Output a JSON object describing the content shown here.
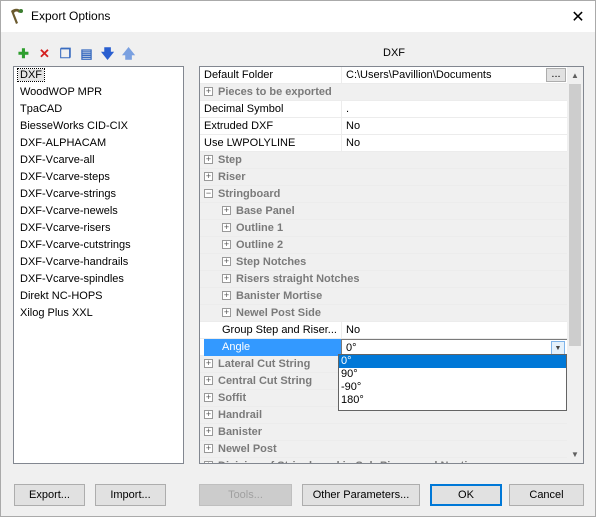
{
  "window": {
    "title": "Export Options",
    "close_glyph": "✕"
  },
  "toolbar": {
    "buttons": [
      {
        "icon": "add-icon",
        "glyph": "✚",
        "color": "#2e9e2e"
      },
      {
        "icon": "delete-icon",
        "glyph": "✕",
        "color": "#d42020"
      },
      {
        "icon": "copy-icon",
        "glyph": "❐",
        "color": "#3a6cc0"
      },
      {
        "icon": "rename-icon",
        "glyph": "▤",
        "color": "#3a6cc0"
      },
      {
        "icon": "move-down-icon",
        "glyph": "🡇",
        "color": "#2a5fd0"
      },
      {
        "icon": "move-up-icon",
        "glyph": "🡅",
        "color": "#7aa0e0"
      }
    ]
  },
  "formats": {
    "items": [
      "DXF",
      "WoodWOP MPR",
      "TpaCAD",
      "BiesseWorks CID-CIX",
      "DXF-ALPHACAM",
      "DXF-Vcarve-all",
      "DXF-Vcarve-steps",
      "DXF-Vcarve-strings",
      "DXF-Vcarve-newels",
      "DXF-Vcarve-risers",
      "DXF-Vcarve-cutstrings",
      "DXF-Vcarve-handrails",
      "DXF-Vcarve-spindles",
      "Direkt NC-HOPS",
      "Xilog Plus XXL"
    ],
    "selected_index": 0
  },
  "properties": {
    "title": "DXF",
    "rows": [
      {
        "type": "prop",
        "name": "Default Folder",
        "value": "C:\\Users\\Pavillion\\Documents",
        "has_browse": true,
        "browse_label": "..."
      },
      {
        "type": "cat",
        "name": "Pieces to be exported",
        "expander": "+"
      },
      {
        "type": "prop",
        "name": "Decimal Symbol",
        "value": "."
      },
      {
        "type": "prop",
        "name": "Extruded DXF",
        "value": "No"
      },
      {
        "type": "prop",
        "name": "Use LWPOLYLINE",
        "value": "No"
      },
      {
        "type": "cat",
        "name": "Step",
        "expander": "+"
      },
      {
        "type": "cat",
        "name": "Riser",
        "expander": "+"
      },
      {
        "type": "cat",
        "name": "Stringboard",
        "expander": "−"
      },
      {
        "type": "subcat",
        "name": "Base Panel",
        "expander": "+"
      },
      {
        "type": "subcat",
        "name": "Outline 1",
        "expander": "+"
      },
      {
        "type": "subcat",
        "name": "Outline 2",
        "expander": "+"
      },
      {
        "type": "subcat",
        "name": "Step Notches",
        "expander": "+"
      },
      {
        "type": "subcat",
        "name": "Risers straight Notches",
        "expander": "+"
      },
      {
        "type": "subcat",
        "name": "Banister Mortise",
        "expander": "+"
      },
      {
        "type": "subcat",
        "name": "Newel Post Side",
        "expander": "+"
      },
      {
        "type": "subprop",
        "name": "Group Step and Riser...",
        "value": "No"
      },
      {
        "type": "subprop-edit",
        "name": "Angle",
        "value": "0°"
      },
      {
        "type": "cat",
        "name": "Lateral Cut String",
        "expander": "+"
      },
      {
        "type": "cat",
        "name": "Central Cut String",
        "expander": "+"
      },
      {
        "type": "cat",
        "name": "Soffit",
        "expander": "+"
      },
      {
        "type": "cat",
        "name": "Handrail",
        "expander": "+"
      },
      {
        "type": "cat",
        "name": "Banister",
        "expander": "+"
      },
      {
        "type": "cat",
        "name": "Newel Post",
        "expander": "+"
      },
      {
        "type": "cat",
        "name": "Division of Stringboard in Sub-Pieces and Nesting",
        "expander": "+"
      }
    ]
  },
  "angle_dropdown": {
    "options": [
      "0°",
      "90°",
      "-90°",
      "180°"
    ],
    "selected_index": 0
  },
  "buttons": {
    "export": "Export...",
    "import": "Import...",
    "tools": "Tools...",
    "other_parameters": "Other Parameters...",
    "ok": "OK",
    "cancel": "Cancel"
  },
  "colors": {
    "selection": "#3399ff",
    "dropdown_selection": "#0078d7",
    "category_text": "#7a7a7a"
  }
}
